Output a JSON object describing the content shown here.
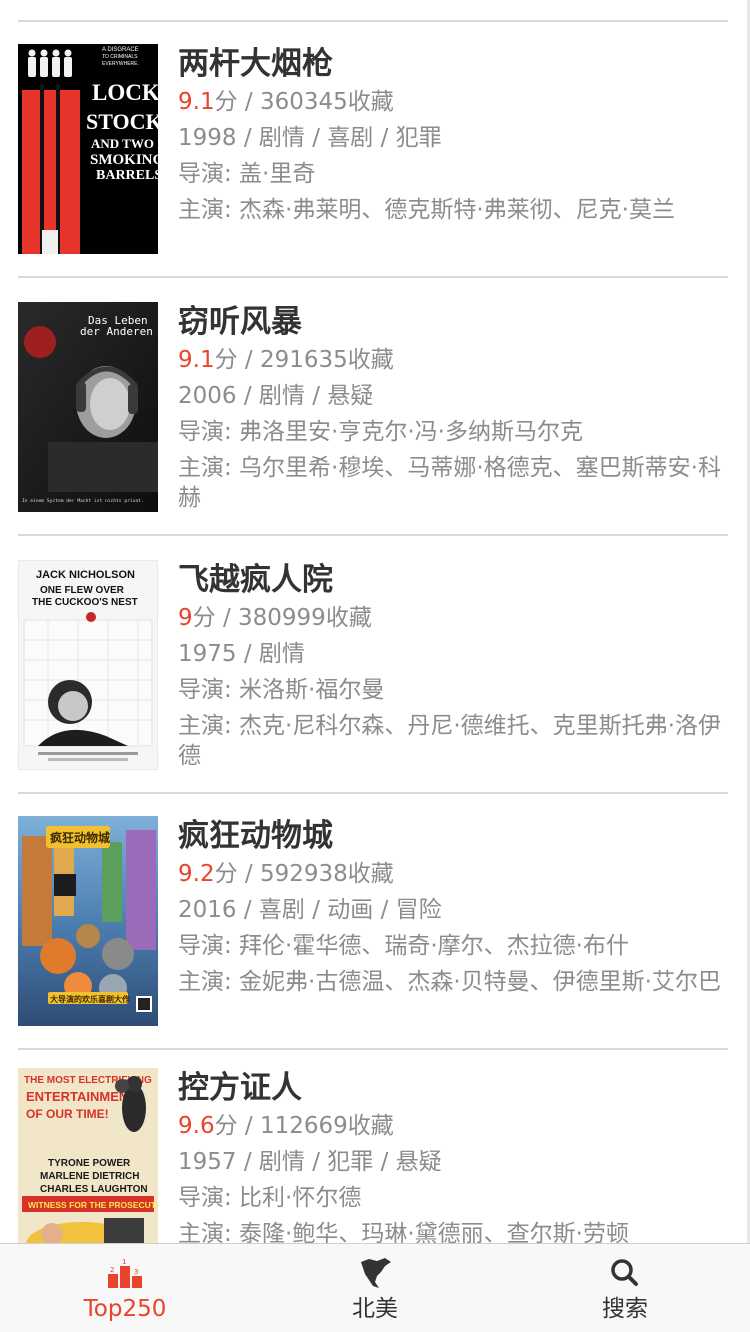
{
  "movies": [
    {
      "title": "两杆大烟枪",
      "score": "9.1",
      "score_unit": "分",
      "sep": " / ",
      "favorites": "360345收藏",
      "meta": "1998 / 剧情 / 喜剧 / 犯罪",
      "director": "导演: 盖·里奇",
      "cast": "主演: 杰森·弗莱明、德克斯特·弗莱彻、尼克·莫兰",
      "poster": {
        "text_1": "A DISGRACE",
        "text_2": "TO CRIMINALS",
        "text_3": "EVERYWHERE.",
        "text_4": "LOCK,",
        "text_5": "STOCK",
        "text_6": "AND TWO",
        "text_7": "SMOKING",
        "text_8": "BARRELS",
        "bg": "#000000",
        "accent": "#e8352b"
      }
    },
    {
      "title": "窃听风暴",
      "score": "9.1",
      "score_unit": "分",
      "sep": " / ",
      "favorites": "291635收藏",
      "meta": "2006 / 剧情 / 悬疑",
      "director": "导演: 弗洛里安·亨克尔·冯·多纳斯马尔克",
      "cast": "主演: 乌尔里希·穆埃、马蒂娜·格德克、塞巴斯蒂安·科赫",
      "poster": {
        "text_1": "Das Leben",
        "text_2": "der Anderen",
        "text_3": "In einem System der Macht ist nichts privat.",
        "bg": "#1c1c1c",
        "accent": "#b3201f"
      }
    },
    {
      "title": "飞越疯人院",
      "score": "9",
      "score_unit": "分",
      "sep": " / ",
      "favorites": "380999收藏",
      "meta": "1975 / 剧情",
      "director": "导演: 米洛斯·福尔曼",
      "cast": "主演: 杰克·尼科尔森、丹尼·德维托、克里斯托弗·洛伊德",
      "poster": {
        "text_1": "JACK NICHOLSON",
        "text_2": "ONE FLEW OVER",
        "text_3": "THE CUCKOO'S NEST",
        "bg": "#f6f6f6",
        "accent": "#c62828"
      }
    },
    {
      "title": "疯狂动物城",
      "score": "9.2",
      "score_unit": "分",
      "sep": " / ",
      "favorites": "592938收藏",
      "meta": "2016 / 喜剧 / 动画 / 冒险",
      "director": "导演: 拜伦·霍华德、瑞奇·摩尔、杰拉德·布什",
      "cast": "主演: 金妮弗·古德温、杰森·贝特曼、伊德里斯·艾尔巴",
      "poster": {
        "text_1": "疯狂动物城",
        "text_2": "大导演的欢乐喜剧大作",
        "bg": "#3a6fa8",
        "accent": "#f3c02f"
      }
    },
    {
      "title": "控方证人",
      "score": "9.6",
      "score_unit": "分",
      "sep": " / ",
      "favorites": "112669收藏",
      "meta": "1957 / 剧情 / 犯罪 / 悬疑",
      "director": "导演: 比利·怀尔德",
      "cast": "主演: 泰隆·鲍华、玛琳·黛德丽、查尔斯·劳顿",
      "poster": {
        "text_1": "THE MOST ELECTRIFYING",
        "text_2": "ENTERTAINMENT",
        "text_3": "OF OUR TIME!",
        "text_4": "TYRONE POWER",
        "text_5": "MARLENE DIETRICH",
        "text_6": "CHARLES LAUGHTON",
        "text_7": "WITNESS FOR THE PROSECUTION",
        "bg": "#f2e6c8",
        "accent": "#d8322a"
      }
    }
  ],
  "tabbar": {
    "tabs": [
      {
        "label": "Top250",
        "icon": "podium-icon",
        "active": true
      },
      {
        "label": "北美",
        "icon": "north-america-icon",
        "active": false
      },
      {
        "label": "搜索",
        "icon": "search-icon",
        "active": false
      }
    ],
    "active_color": "#e9442b",
    "inactive_color": "#333333",
    "podium_numbers": [
      "1",
      "2",
      "3"
    ]
  }
}
